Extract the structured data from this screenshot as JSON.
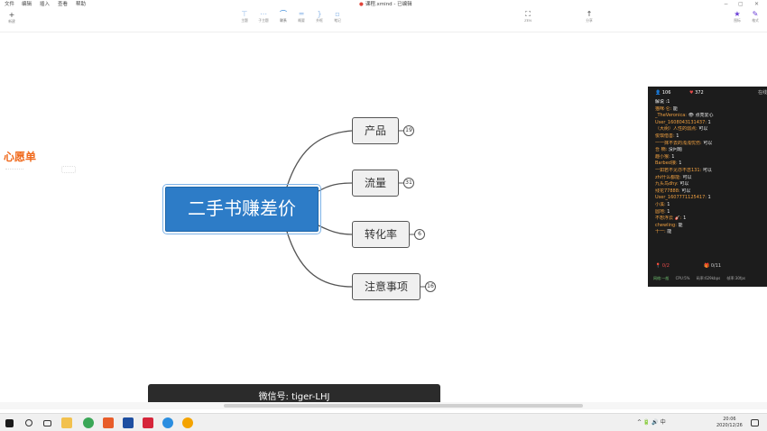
{
  "menu": {
    "items": [
      "文件",
      "编辑",
      "插入",
      "查看",
      "帮助"
    ],
    "doc_title": "课程.xmind - 已编辑",
    "window_controls": [
      "−",
      "▢",
      "✕"
    ]
  },
  "toolbar": {
    "new_label": "新建",
    "tools": [
      {
        "icon": "topic-icon",
        "label": "主题"
      },
      {
        "icon": "subtopic-icon",
        "label": "子主题"
      },
      {
        "icon": "relationship-icon",
        "label": "联系"
      },
      {
        "icon": "summary-icon",
        "label": "概要"
      },
      {
        "icon": "boundary-icon",
        "label": "外框"
      },
      {
        "icon": "note-icon",
        "label": "笔记"
      }
    ],
    "zen_label": "ZEN",
    "share_label": "分享",
    "icon_label": "图标",
    "format_label": "格式"
  },
  "canvas": {
    "wish_title": "心愿单",
    "central_topic": "二手书赚差价",
    "branches": [
      {
        "label": "产品",
        "count": "19"
      },
      {
        "label": "流量",
        "count": "31"
      },
      {
        "label": "转化率",
        "count": "6"
      },
      {
        "label": "注意事项",
        "count": "16"
      }
    ]
  },
  "live": {
    "viewers": "106",
    "likes": "372",
    "online_label": "在线",
    "messages": [
      {
        "name": "",
        "text": "解说 :1"
      },
      {
        "name": "猫咪·仑:",
        "text": "能"
      },
      {
        "name": "_TheVeronica:",
        "text": "👁 点亮爱心"
      },
      {
        "name": "User_1608043131437:",
        "text": "1"
      },
      {
        "name": "（大树）人性的弱点:",
        "text": "可以"
      },
      {
        "name": "俊琪借善:",
        "text": "1"
      },
      {
        "name": "一一抹不去的浅浅忧伤:",
        "text": "可以"
      },
      {
        "name": "吾 楠:",
        "text": "没问题"
      },
      {
        "name": "趣小猴:",
        "text": "1"
      },
      {
        "name": "Barbed接:",
        "text": "1"
      },
      {
        "name": "一如若不见亦不念131:",
        "text": "可以"
      },
      {
        "name": "zhi什么都能:",
        "text": "可以"
      },
      {
        "name": "九头鸟dhy:",
        "text": "可以"
      },
      {
        "name": "残花77888:",
        "text": "可以"
      },
      {
        "name": "User_1607771125417:",
        "text": "1"
      },
      {
        "name": "小溪:",
        "text": "1"
      },
      {
        "name": "圆地:",
        "text": "1"
      },
      {
        "name": "不想浮云 🎸:",
        "text": "1"
      },
      {
        "name": "chewling:",
        "text": "能"
      },
      {
        "name": "十一:",
        "text": "能"
      }
    ],
    "footer_left": "0/2",
    "footer_right": "0/11",
    "stats_net": "网络:一般",
    "stats_cpu": "CPU:5%",
    "stats_up": "码率:629kbps",
    "stats_fps": "帧率:30fps"
  },
  "subtitle": "微信号: tiger-LHJ",
  "taskbar": {
    "tray_text": "^ 🔋 🔊 中",
    "time": "20:06",
    "date": "2020/12/26"
  },
  "colors": {
    "central_fill": "#2d7cc7",
    "wish_orange": "#f06a1d",
    "panel_bg": "#1c1c1c"
  }
}
